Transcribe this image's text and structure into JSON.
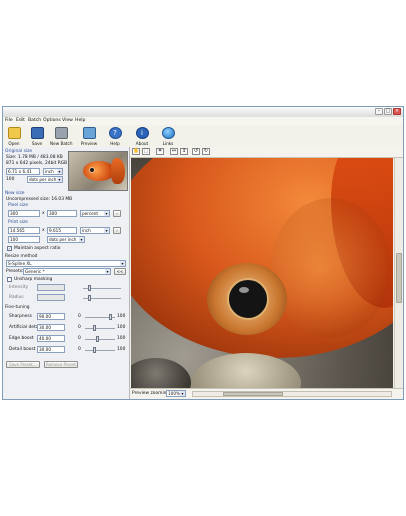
{
  "menu": [
    "File",
    "Edit",
    "Batch",
    "Options",
    "View",
    "Help"
  ],
  "toolbar": [
    {
      "label": "Open",
      "icon": "folder-icon"
    },
    {
      "label": "Save",
      "icon": "floppy-icon"
    },
    {
      "label": "New Batch",
      "icon": "batch-icon"
    },
    {
      "label": "Preview",
      "icon": "preview-icon"
    },
    {
      "label": "Help",
      "icon": "help-icon"
    },
    {
      "label": "About",
      "icon": "info-icon"
    },
    {
      "label": "Links",
      "icon": "globe-icon"
    }
  ],
  "original": {
    "title": "Original size",
    "size_line": "Size: 1.78 MB / 483.08 KB",
    "pixels_line": "871 x 642 pixels, 24bit RGB",
    "dims_value": "6.71 x 6.41",
    "dims_unit": "inch",
    "dpi_label": "100",
    "dpi_unit": "dots per inch"
  },
  "newsize": {
    "title": "New size",
    "uncompressed": "Uncompressed size: 16.03 MB",
    "pixel_title": "Pixel size",
    "width": "300",
    "height": "300",
    "pixel_unit": "percent",
    "print_title": "Print size",
    "print_w": "14.565",
    "print_h": "9.615",
    "print_unit": "inch",
    "res_value": "100",
    "res_unit": "dots per inch",
    "aspect_label": "Maintain aspect ratio"
  },
  "resize": {
    "title": "Resize method",
    "method": "S-Spline XL",
    "presets_label": "Presets:",
    "preset_value": "Generic *",
    "preset_btn": "<<",
    "unsharp_label": "Unsharp masking",
    "intensity_label": "Intensity",
    "radius_label": "Radius"
  },
  "finetune": {
    "title": "Fine-tuning",
    "rows": [
      {
        "label": "Sharpness",
        "value": "90.00",
        "min": "0",
        "max": "100",
        "level": 0.9
      },
      {
        "label": "Artificial detail",
        "value": "30.00",
        "min": "0",
        "max": "100",
        "level": 0.3
      },
      {
        "label": "Edge boost",
        "value": "40.00",
        "min": "0",
        "max": "100",
        "level": 0.4
      },
      {
        "label": "Detail boost",
        "value": "30.00",
        "min": "0",
        "max": "100",
        "level": 0.3
      }
    ],
    "save_btn": "Save Preset...",
    "remove_btn": "Remove Preset"
  },
  "preview": {
    "zoom_label": "Preview zooming:",
    "zoom_value": "100%"
  },
  "colors": {
    "accent": "#2c4f93",
    "fish_orange": "#d8581b",
    "eye_dark": "#141414"
  }
}
